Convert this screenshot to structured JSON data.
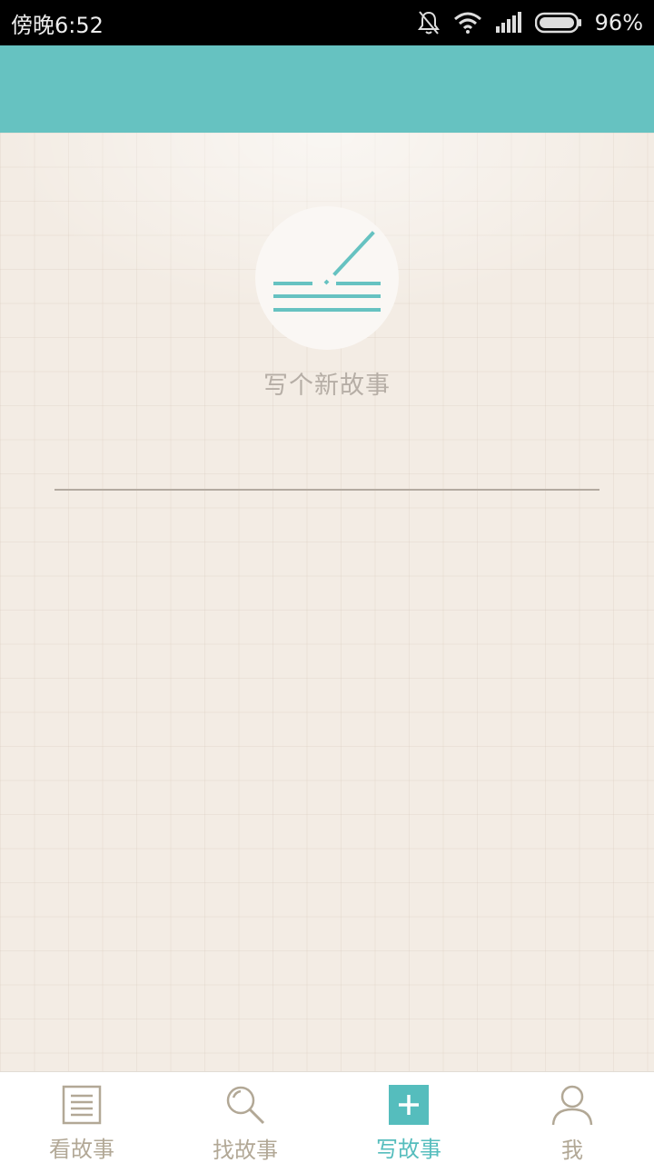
{
  "status_bar": {
    "time": "傍晚6:52",
    "battery": "96%",
    "icons": [
      "bell-muted-icon",
      "wifi-icon",
      "signal-icon",
      "battery-icon"
    ]
  },
  "main": {
    "write_new_story_label": "写个新故事",
    "write_icon": "pen-lines-icon"
  },
  "tabs": [
    {
      "label": "看故事",
      "icon": "document-icon",
      "active": false
    },
    {
      "label": "找故事",
      "icon": "search-icon",
      "active": false
    },
    {
      "label": "写故事",
      "icon": "plus-icon",
      "active": true
    },
    {
      "label": "我",
      "icon": "user-icon",
      "active": false
    }
  ],
  "colors": {
    "accent": "#66c2c1",
    "tab_active": "#55bdbd",
    "tab_inactive": "#b2a896",
    "paper": "#f3ece4"
  }
}
